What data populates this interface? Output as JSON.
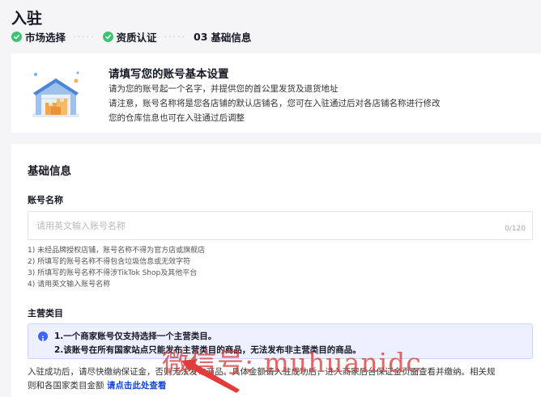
{
  "page": {
    "title": "入驻"
  },
  "steps": [
    {
      "label": "市场选择",
      "state": "done"
    },
    {
      "label": "资质认证",
      "state": "done"
    },
    {
      "number": "03",
      "label": "基础信息",
      "state": "current"
    }
  ],
  "intro": {
    "title": "请填写您的账号基本设置",
    "lines": [
      "请为您的账号起一个名字，并提供您的首公里发货及退货地址",
      "请注意，账号名称将是您各店铺的默认店铺名，您可在入驻通过后对各店铺名称进行修改",
      "您的仓库信息也可在入驻通过后调整"
    ],
    "illustration": "warehouse-icon"
  },
  "form": {
    "section_title": "基础信息",
    "account_name": {
      "label": "账号名称",
      "placeholder": "请用英文输入账号名称",
      "value": "",
      "counter": "0/120",
      "rules": [
        "1) 未经品牌授权店铺，账号名称不得为官方店或旗舰店",
        "2) 所填写的账号名称不得包含垃圾信息或无效字符",
        "3) 所填写的账号名称不得涉TikTok Shop及其他平台",
        "4) 请用英文输入账号名称"
      ]
    },
    "main_category": {
      "label": "主营类目",
      "notice": [
        "1.一个商家账号仅支持选择一个主营类目。",
        "2.该账号在所有国家站点只能发布主营类目的商品，无法发布非主营类目的商品。"
      ],
      "after_text_1": "入驻成功后，请尽快缴纳保证金，否则无法发布商品。具体金额请入驻成功后，进入商家后台保证金页面查看并缴纳。相关规",
      "after_text_2": "则和各国家类目金额 ",
      "after_link": "请点击此处查看"
    }
  },
  "watermark": "微信号: muhuanidc",
  "colors": {
    "check_green": "#3ec372",
    "info_blue": "#3e65f5",
    "link_blue": "#1644d6",
    "watermark_red": "#d63e3e"
  }
}
